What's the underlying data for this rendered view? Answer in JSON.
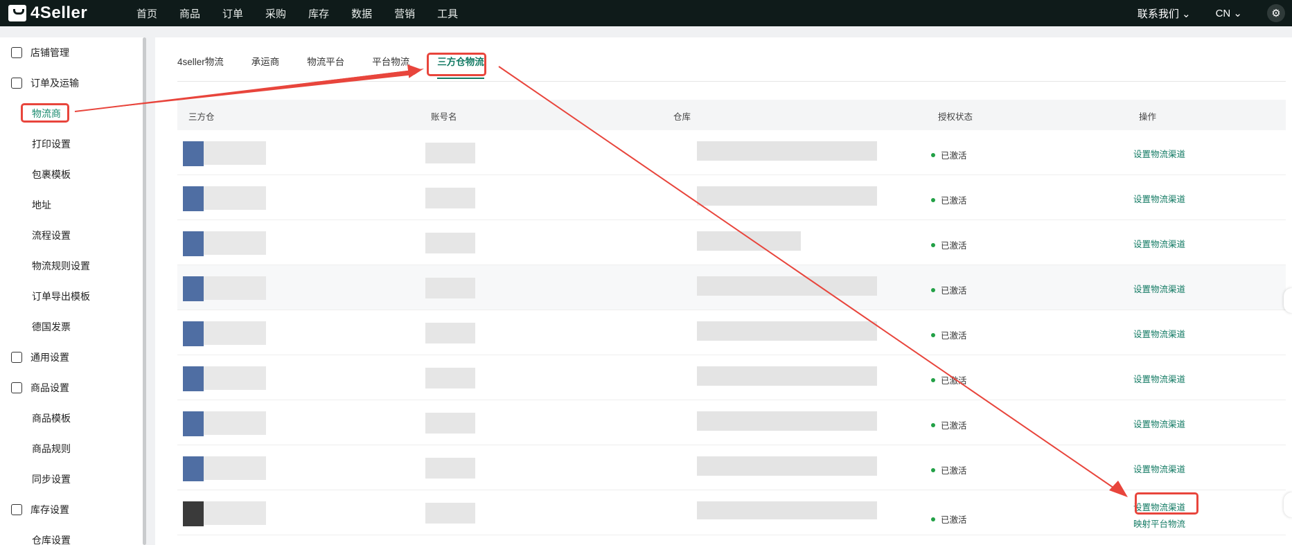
{
  "topbar": {
    "logo": "4Seller",
    "nav": [
      "首页",
      "商品",
      "订单",
      "采购",
      "库存",
      "数据",
      "营销",
      "工具"
    ],
    "contact": "联系我们",
    "lang": "CN",
    "gear_icon": "gear-icon"
  },
  "sidebar": {
    "groups": [
      {
        "label": "店铺管理",
        "icon": "store-icon"
      },
      {
        "label": "订单及运输",
        "icon": "order-icon"
      },
      {
        "label": "物流商"
      },
      {
        "label": "打印设置"
      },
      {
        "label": "包裹模板"
      },
      {
        "label": "地址"
      },
      {
        "label": "流程设置"
      },
      {
        "label": "物流规则设置"
      },
      {
        "label": "订单导出模板"
      },
      {
        "label": "德国发票"
      },
      {
        "label": "通用设置",
        "icon": "settings-icon"
      },
      {
        "label": "商品设置",
        "icon": "product-icon"
      },
      {
        "label": "商品模板"
      },
      {
        "label": "商品规则"
      },
      {
        "label": "同步设置"
      },
      {
        "label": "库存设置",
        "icon": "inventory-icon"
      },
      {
        "label": "仓库设置"
      }
    ],
    "active_label": "物流商"
  },
  "tabs": [
    "4seller物流",
    "承运商",
    "物流平台",
    "平台物流",
    "三方仓物流"
  ],
  "active_tab": "三方仓物流",
  "table": {
    "headers": [
      "三方仓",
      "账号名",
      "仓库",
      "授权状态",
      "操作"
    ],
    "rows": [
      {
        "status": "已激活",
        "action": "设置物流渠道"
      },
      {
        "status": "已激活",
        "action": "设置物流渠道"
      },
      {
        "status": "已激活",
        "action": "设置物流渠道"
      },
      {
        "status": "已激活",
        "action": "设置物流渠道"
      },
      {
        "status": "已激活",
        "action": "设置物流渠道"
      },
      {
        "status": "已激活",
        "action": "设置物流渠道"
      },
      {
        "status": "已激活",
        "action": "设置物流渠道"
      },
      {
        "status": "已激活",
        "action": "设置物流渠道"
      },
      {
        "status": "已激活",
        "action": "设置物流渠道",
        "action2": "映射平台物流"
      }
    ]
  },
  "colors": {
    "accent": "#127a63",
    "highlight": "#e8453c",
    "status_dot": "#22a046"
  }
}
